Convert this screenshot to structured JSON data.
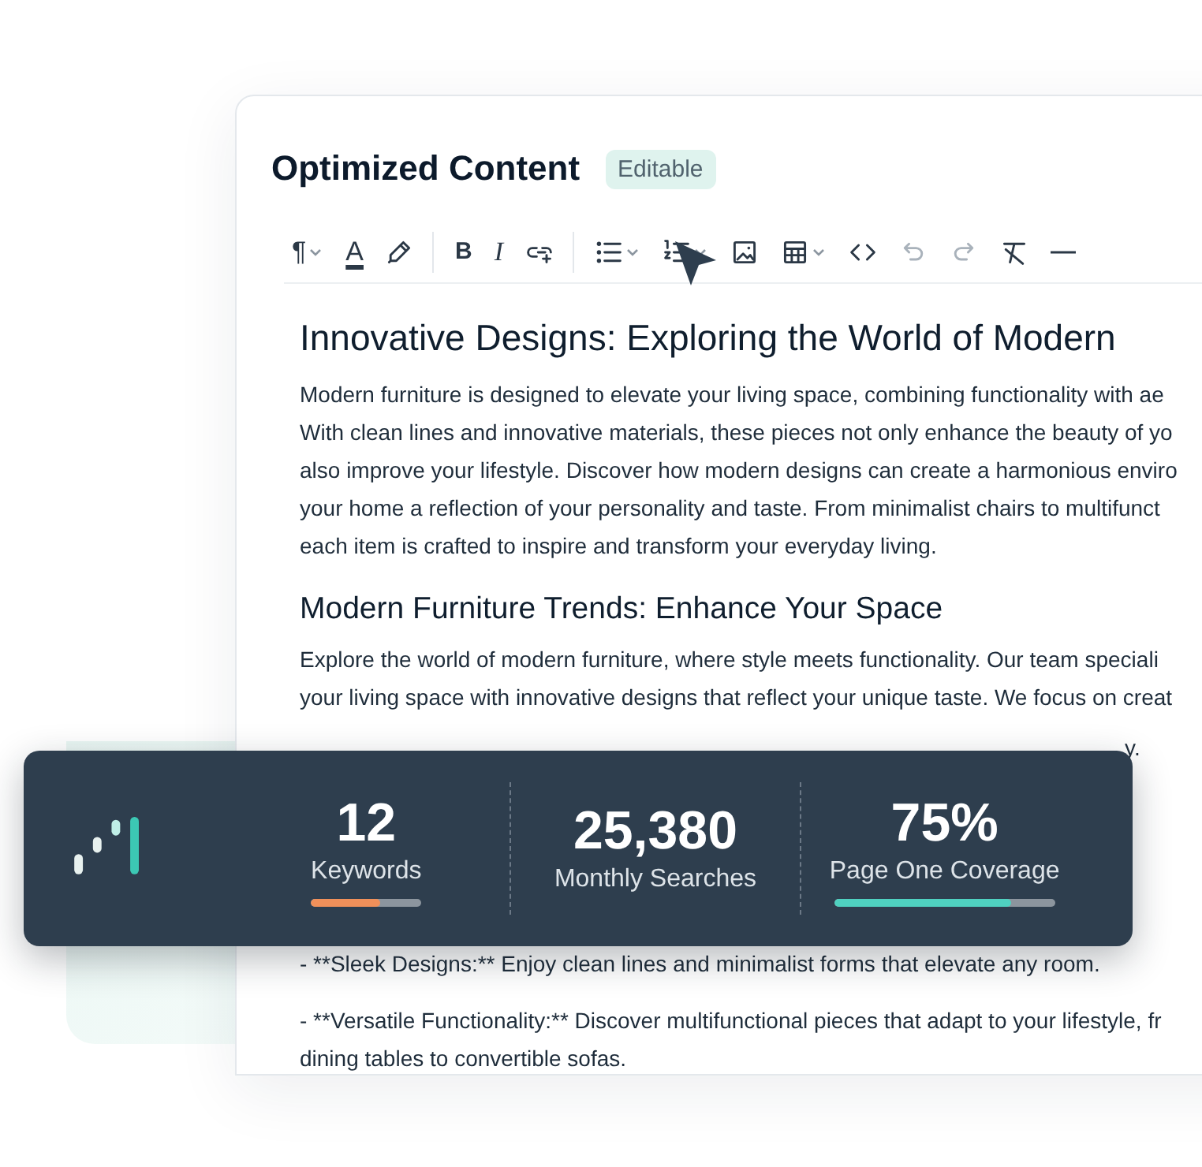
{
  "editor": {
    "title": "Optimized Content",
    "badge": "Editable",
    "toolbar": [
      {
        "kind": "glyph",
        "glyph": "¶",
        "dropdown": true,
        "disabled": false,
        "separator_after": false
      },
      {
        "kind": "text-color",
        "glyph": "A",
        "dropdown": false,
        "disabled": false,
        "separator_after": false
      },
      {
        "kind": "highlighter",
        "dropdown": false,
        "disabled": false,
        "separator_after": true
      },
      {
        "kind": "bold",
        "glyph": "B",
        "dropdown": false,
        "disabled": false,
        "separator_after": false
      },
      {
        "kind": "italic",
        "glyph": "I",
        "dropdown": false,
        "disabled": false,
        "separator_after": false
      },
      {
        "kind": "link",
        "dropdown": false,
        "disabled": false,
        "separator_after": true
      },
      {
        "kind": "bullet-list",
        "dropdown": true,
        "disabled": false,
        "separator_after": false
      },
      {
        "kind": "numbered-list",
        "dropdown": true,
        "disabled": false,
        "separator_after": false
      },
      {
        "kind": "image",
        "dropdown": false,
        "disabled": false,
        "separator_after": false
      },
      {
        "kind": "table",
        "dropdown": true,
        "disabled": false,
        "separator_after": false
      },
      {
        "kind": "code",
        "dropdown": false,
        "disabled": false,
        "separator_after": false
      },
      {
        "kind": "undo",
        "dropdown": false,
        "disabled": true,
        "separator_after": false
      },
      {
        "kind": "redo",
        "dropdown": false,
        "disabled": true,
        "separator_after": false
      },
      {
        "kind": "clear-format",
        "dropdown": false,
        "disabled": false,
        "separator_after": false
      },
      {
        "kind": "horizontal-rule",
        "dropdown": false,
        "disabled": false,
        "separator_after": false
      }
    ],
    "content": [
      {
        "kind": "h1",
        "lines": [
          "Innovative Designs: Exploring the World of Modern"
        ]
      },
      {
        "kind": "p",
        "lines": [
          "Modern furniture is designed to elevate your living space, combining functionality with ae",
          "With clean lines and innovative materials, these pieces not only enhance the beauty of yo",
          "also improve your lifestyle. Discover how modern designs can create a harmonious enviro",
          "your home a reflection of your personality and taste. From minimalist chairs to multifunct",
          "each item is crafted to inspire and transform your everyday living."
        ]
      },
      {
        "kind": "h2",
        "lines": [
          "Modern Furniture Trends: Enhance Your Space"
        ]
      },
      {
        "kind": "p",
        "lines": [
          "Explore the world of modern furniture, where style meets functionality. Our team speciali",
          "your living space with innovative designs that reflect your unique taste. We focus on creat"
        ]
      },
      {
        "kind": "tail",
        "lines": [
          "y."
        ]
      },
      {
        "kind": "li",
        "lines": [
          "- **Sleek Designs:** Enjoy clean lines and minimalist forms that elevate any room."
        ]
      },
      {
        "kind": "li",
        "lines": [
          "- **Versatile Functionality:** Discover multifunctional pieces that adapt to your lifestyle, fr",
          "dining tables to convertible sofas."
        ]
      }
    ]
  },
  "stats": [
    {
      "value": "12",
      "label": "Keywords",
      "level": 0.62,
      "color": "#f0905a"
    },
    {
      "value": "25,380",
      "label": "Monthly Searches"
    },
    {
      "value": "75%",
      "label": "Page One Coverage",
      "level": 0.8,
      "color": "#4fd1c0"
    }
  ]
}
